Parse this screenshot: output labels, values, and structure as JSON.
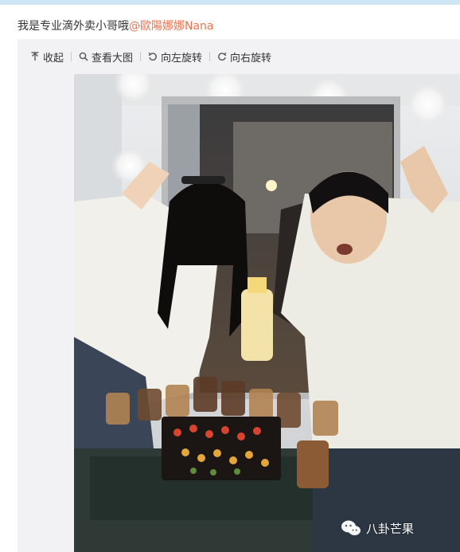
{
  "post": {
    "text": "我是专业滴外卖小哥哦",
    "mention": "@歐陽娜娜Nana"
  },
  "toolbar": {
    "collapse_label": "收起",
    "view_large_label": "查看大图",
    "rotate_left_label": "向左旋转",
    "rotate_right_label": "向右旋转"
  },
  "photo": {
    "watermark_text": "八卦芒果",
    "watermark_icon": "wechat-icon"
  },
  "colors": {
    "mention": "#eb7350",
    "viewer_bg": "#f2f2f5",
    "accent_strip": "#cfe6f7"
  }
}
